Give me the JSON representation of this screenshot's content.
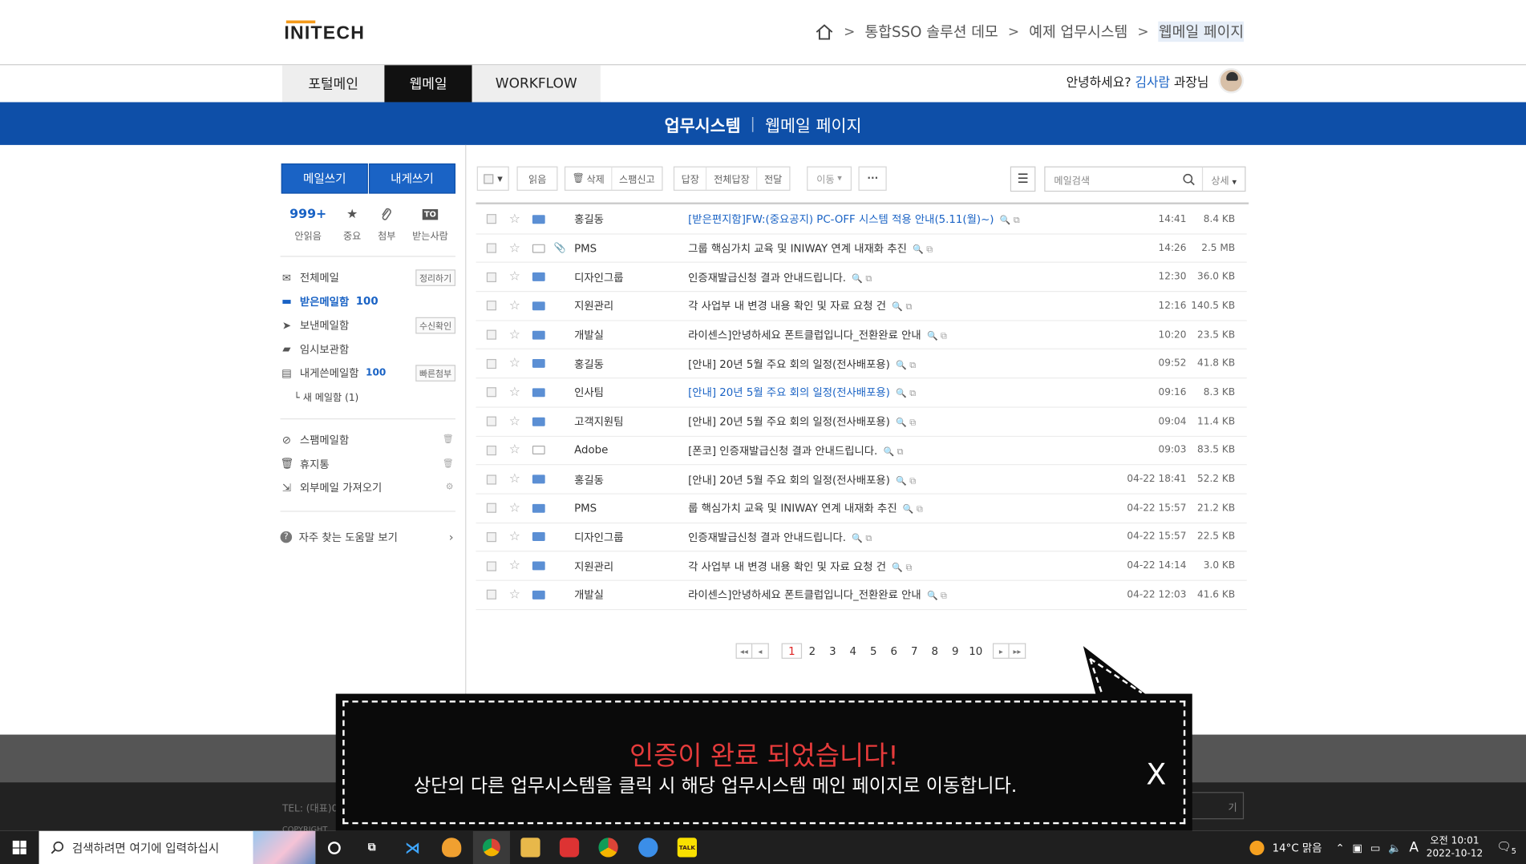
{
  "logo": "INITECH",
  "breadcrumb": [
    "통합SSO 솔루션 데모",
    "예제 업무시스템",
    "웹메일 페이지"
  ],
  "tabs": [
    "포털메인",
    "웹메일",
    "WORKFLOW"
  ],
  "greeting": {
    "prefix": "안녕하세요?",
    "name": "김사람",
    "suffix": "과장님"
  },
  "banner": {
    "bold": "업무시스템",
    "sep": "|",
    "text": "웹메일 페이지"
  },
  "sidebar": {
    "write_mail": "메일쓰기",
    "write_self": "내게쓰기",
    "quick": [
      {
        "top": "999+",
        "label": "안읽음",
        "icon": "count"
      },
      {
        "top": "★",
        "label": "중요",
        "icon": "star-icon"
      },
      {
        "top": "📎",
        "label": "첨부",
        "icon": "paperclip-icon"
      },
      {
        "top": "TO",
        "label": "받는사람",
        "icon": "to-icon"
      }
    ],
    "folders": [
      {
        "label": "전체메일",
        "icon": "envelope-icon",
        "tag": "정리하기"
      },
      {
        "label": "받은메일함",
        "icon": "inbox-icon",
        "count": "100",
        "active": true
      },
      {
        "label": "보낸메일함",
        "icon": "send-icon",
        "tag": "수신확인"
      },
      {
        "label": "임시보관함",
        "icon": "folder-icon"
      },
      {
        "label": "내게쓴메일함",
        "icon": "note-icon",
        "count": "100",
        "tag": "빠른첨부"
      },
      {
        "label": "└ 새 메일함 (1)",
        "icon": "none"
      }
    ],
    "folders2": [
      {
        "label": "스팸메일함",
        "icon": "block-icon"
      },
      {
        "label": "휴지통",
        "icon": "trash-icon"
      },
      {
        "label": "외부메일 가져오기",
        "icon": "import-icon"
      }
    ],
    "help": "자주 찾는 도움말 보기"
  },
  "toolbar": {
    "read": "읽음",
    "delete": "삭제",
    "spam": "스팸신고",
    "reply": "답장",
    "reply_all": "전체답장",
    "forward": "전달",
    "move": "이동",
    "more": "···",
    "search_placeholder": "메일검색",
    "detail": "상세"
  },
  "mails": [
    {
      "from": "홍길동",
      "subject": "[받은편지함]FW:(중요공지) PC-OFF 시스템 적용 안내(5.11(월)~)",
      "time": "14:41",
      "size": "8.4 KB",
      "unread": true,
      "blue": true,
      "clip": false
    },
    {
      "from": "PMS",
      "subject": "그룹 핵심가치 교육 및 INIWAY 연계 내재화 추진",
      "time": "14:26",
      "size": "2.5 MB",
      "unread": false,
      "blue": false,
      "clip": true
    },
    {
      "from": "디자인그룹",
      "subject": "인증재발급신청 결과 안내드립니다.",
      "time": "12:30",
      "size": "36.0 KB",
      "unread": true,
      "blue": false,
      "clip": false
    },
    {
      "from": "지원관리",
      "subject": "각 사업부 내 변경 내용 확인 및 자료 요청 건",
      "time": "12:16",
      "size": "140.5 KB",
      "unread": true,
      "blue": false,
      "clip": false
    },
    {
      "from": "개발실",
      "subject": "라이센스]안녕하세요 폰트클럽입니다_전환완료 안내",
      "time": "10:20",
      "size": "23.5 KB",
      "unread": true,
      "blue": false,
      "clip": false
    },
    {
      "from": "홍길동",
      "subject": "[안내] 20년 5월 주요 회의 일정(전사배포용)",
      "time": "09:52",
      "size": "41.8 KB",
      "unread": true,
      "blue": false,
      "clip": false
    },
    {
      "from": "인사팀",
      "subject": "[안내] 20년 5월 주요 회의 일정(전사배포용)",
      "time": "09:16",
      "size": "8.3 KB",
      "unread": true,
      "blue": true,
      "clip": false
    },
    {
      "from": "고객지원팀",
      "subject": "[안내] 20년 5월 주요 회의 일정(전사배포용)",
      "time": "09:04",
      "size": "11.4 KB",
      "unread": true,
      "blue": false,
      "clip": false
    },
    {
      "from": "Adobe",
      "subject": "[폰코] 인증재발급신청 결과 안내드립니다.",
      "time": "09:03",
      "size": "83.5 KB",
      "unread": false,
      "blue": false,
      "clip": false
    },
    {
      "from": "홍길동",
      "subject": "[안내] 20년 5월 주요 회의 일정(전사배포용)",
      "time": "04-22 18:41",
      "size": "52.2 KB",
      "unread": true,
      "blue": false,
      "clip": false
    },
    {
      "from": "PMS",
      "subject": "룹 핵심가치 교육 및 INIWAY 연계 내재화 추진",
      "time": "04-22 15:57",
      "size": "21.2 KB",
      "unread": true,
      "blue": false,
      "clip": false
    },
    {
      "from": "디자인그룹",
      "subject": "인증재발급신청 결과 안내드립니다.",
      "time": "04-22 15:57",
      "size": "22.5 KB",
      "unread": true,
      "blue": false,
      "clip": false
    },
    {
      "from": "지원관리",
      "subject": "각 사업부 내 변경 내용 확인 및 자료 요청 건",
      "time": "04-22 14:14",
      "size": "3.0 KB",
      "unread": true,
      "blue": false,
      "clip": false
    },
    {
      "from": "개발실",
      "subject": "라이센스]안녕하세요 폰트클럽입니다_전환완료 안내",
      "time": "04-22 12:03",
      "size": "41.6 KB",
      "unread": true,
      "blue": false,
      "clip": false
    }
  ],
  "pager": {
    "pages": [
      "1",
      "2",
      "3",
      "4",
      "5",
      "6",
      "7",
      "8",
      "9",
      "10"
    ],
    "current": "1"
  },
  "footer": {
    "tel": "TEL: (대표)0",
    "copy": "COPYRIGHT",
    "family": "기"
  },
  "popup": {
    "title": "인증이 완료 되었습니다!",
    "message": "상단의 다른 업무시스템을 클릭 시 해당 업무시스템 메인 페이지로 이동합니다.",
    "close": "X"
  },
  "taskbar": {
    "search_placeholder": "검색하려면 여기에 입력하십시",
    "weather": "14°C  맑음",
    "ime": "A",
    "time": "오전 10:01",
    "date": "2022-10-12",
    "notif": "5"
  },
  "colors": {
    "brand_blue": "#0e4fa8",
    "accent_blue": "#1a63c5",
    "alert_red": "#e63b3b"
  }
}
